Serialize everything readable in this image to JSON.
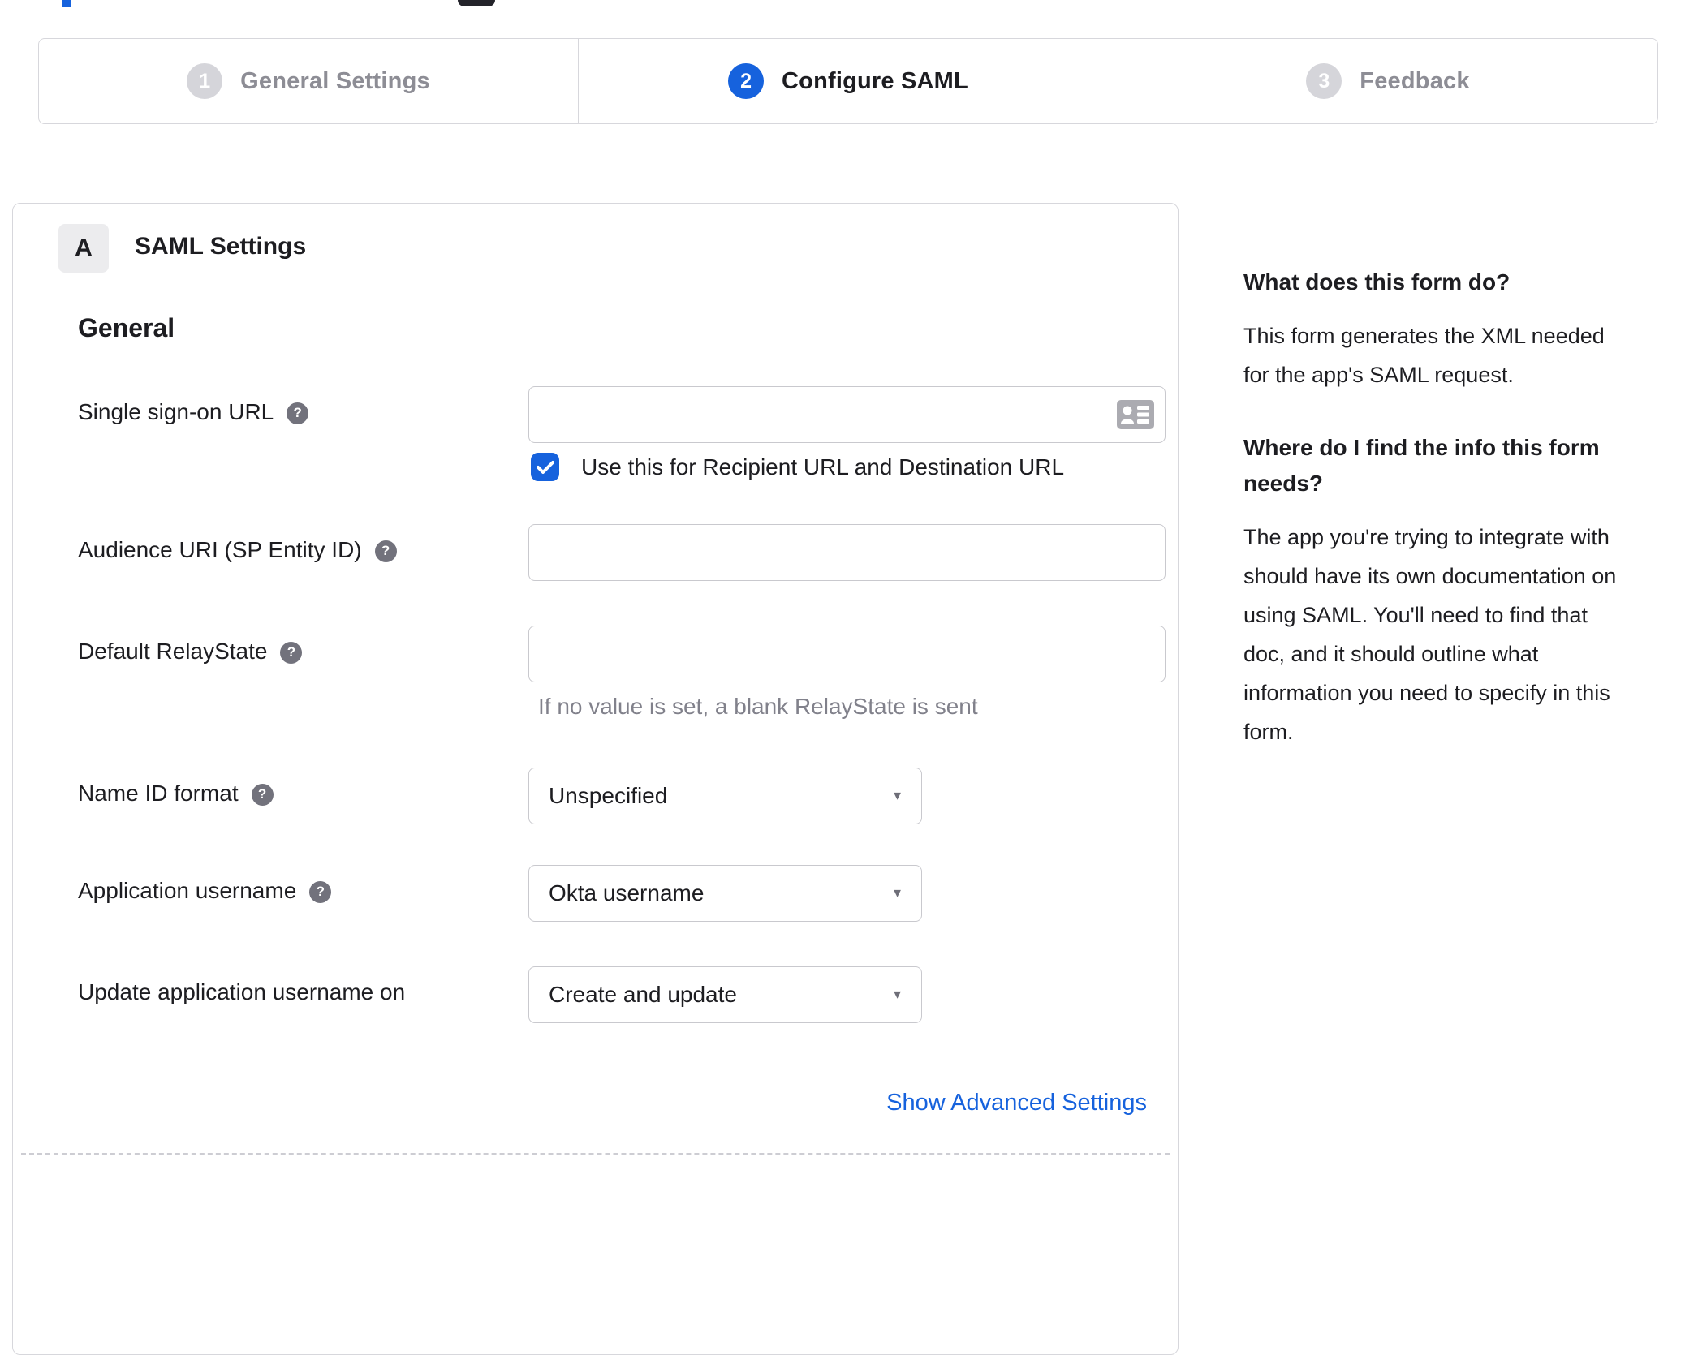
{
  "colors": {
    "accent_blue": "#1662dd",
    "border_gray": "#d7d7dc",
    "text_dark": "#1d1d21",
    "inactive_gray": "#8d8d95",
    "hint_gray": "#81818b"
  },
  "glyphs": {
    "help": "?",
    "select_arrow": "▼"
  },
  "stepper": {
    "steps": [
      {
        "number": "1",
        "label": "General Settings",
        "state": "inactive"
      },
      {
        "number": "2",
        "label": "Configure SAML",
        "state": "active"
      },
      {
        "number": "3",
        "label": "Feedback",
        "state": "inactive"
      }
    ]
  },
  "panel": {
    "badge": "A",
    "title": "SAML Settings",
    "section_heading": "General",
    "fields": [
      {
        "label": "Single sign-on URL",
        "value": "",
        "has_help": true,
        "type": "text",
        "checkbox_label": "Use this for Recipient URL and Destination URL",
        "checkbox_checked": true
      },
      {
        "label": "Audience URI (SP Entity ID)",
        "value": "",
        "has_help": true,
        "type": "text"
      },
      {
        "label": "Default RelayState",
        "value": "",
        "has_help": true,
        "type": "text",
        "hint": "If no value is set, a blank RelayState is sent"
      },
      {
        "label": "Name ID format",
        "value": "Unspecified",
        "has_help": true,
        "type": "select"
      },
      {
        "label": "Application username",
        "value": "Okta username",
        "has_help": true,
        "type": "select"
      },
      {
        "label": "Update application username on",
        "value": "Create and update",
        "has_help": false,
        "type": "select"
      }
    ],
    "advanced_link": "Show Advanced Settings"
  },
  "sidebar": {
    "heading1": "What does this form do?",
    "para1": "This form generates the XML needed for the app's SAML request.",
    "heading2": "Where do I find the info this form needs?",
    "para2": "The app you're trying to integrate with should have its own documentation on using SAML. You'll need to find that doc, and it should outline what information you need to specify in this form."
  }
}
